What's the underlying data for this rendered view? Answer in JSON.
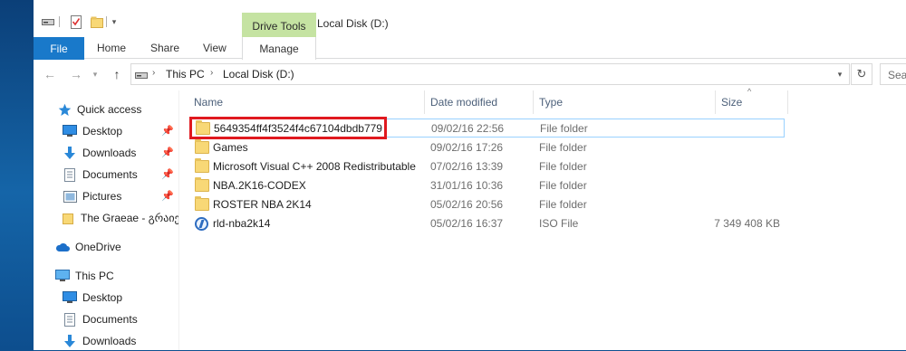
{
  "window": {
    "title": "Local Disk (D:)"
  },
  "ribbon": {
    "context_label": "Drive Tools",
    "tabs": [
      "File",
      "Home",
      "Share",
      "View",
      "Manage"
    ]
  },
  "address": {
    "crumbs": [
      "This PC",
      "Local Disk (D:)"
    ],
    "search_placeholder": "Search Local Disk (D:)"
  },
  "sidebar": {
    "quick_access": "Quick access",
    "quick_items": [
      "Desktop",
      "Downloads",
      "Documents",
      "Pictures",
      "The Graeae - გრაიე"
    ],
    "onedrive": "OneDrive",
    "this_pc": "This PC",
    "pc_items": [
      "Desktop",
      "Documents",
      "Downloads"
    ]
  },
  "columns": {
    "name": "Name",
    "date": "Date modified",
    "type": "Type",
    "size": "Size"
  },
  "files": [
    {
      "name": "5649354ff4f3524f4c67104dbdb779",
      "date": "09/02/16 22:56",
      "type": "File folder",
      "size": "",
      "icon": "folder-icon"
    },
    {
      "name": "Games",
      "date": "09/02/16 17:26",
      "type": "File folder",
      "size": "",
      "icon": "folder-icon"
    },
    {
      "name": "Microsoft Visual C++ 2008 Redistributable",
      "date": "07/02/16 13:39",
      "type": "File folder",
      "size": "",
      "icon": "folder-icon"
    },
    {
      "name": "NBA.2K16-CODEX",
      "date": "31/01/16 10:36",
      "type": "File folder",
      "size": "",
      "icon": "folder-icon"
    },
    {
      "name": "ROSTER NBA 2K14",
      "date": "05/02/16 20:56",
      "type": "File folder",
      "size": "",
      "icon": "folder-icon"
    },
    {
      "name": "rld-nba2k14",
      "date": "05/02/16 16:37",
      "type": "ISO File",
      "size": "7 349 408 KB",
      "icon": "iso-disc-icon"
    }
  ],
  "colors": {
    "accent": "#1979ca",
    "drive_tools": "#c5e3a2",
    "highlight_box": "#e0191f",
    "selection_border": "#99d1ff"
  }
}
